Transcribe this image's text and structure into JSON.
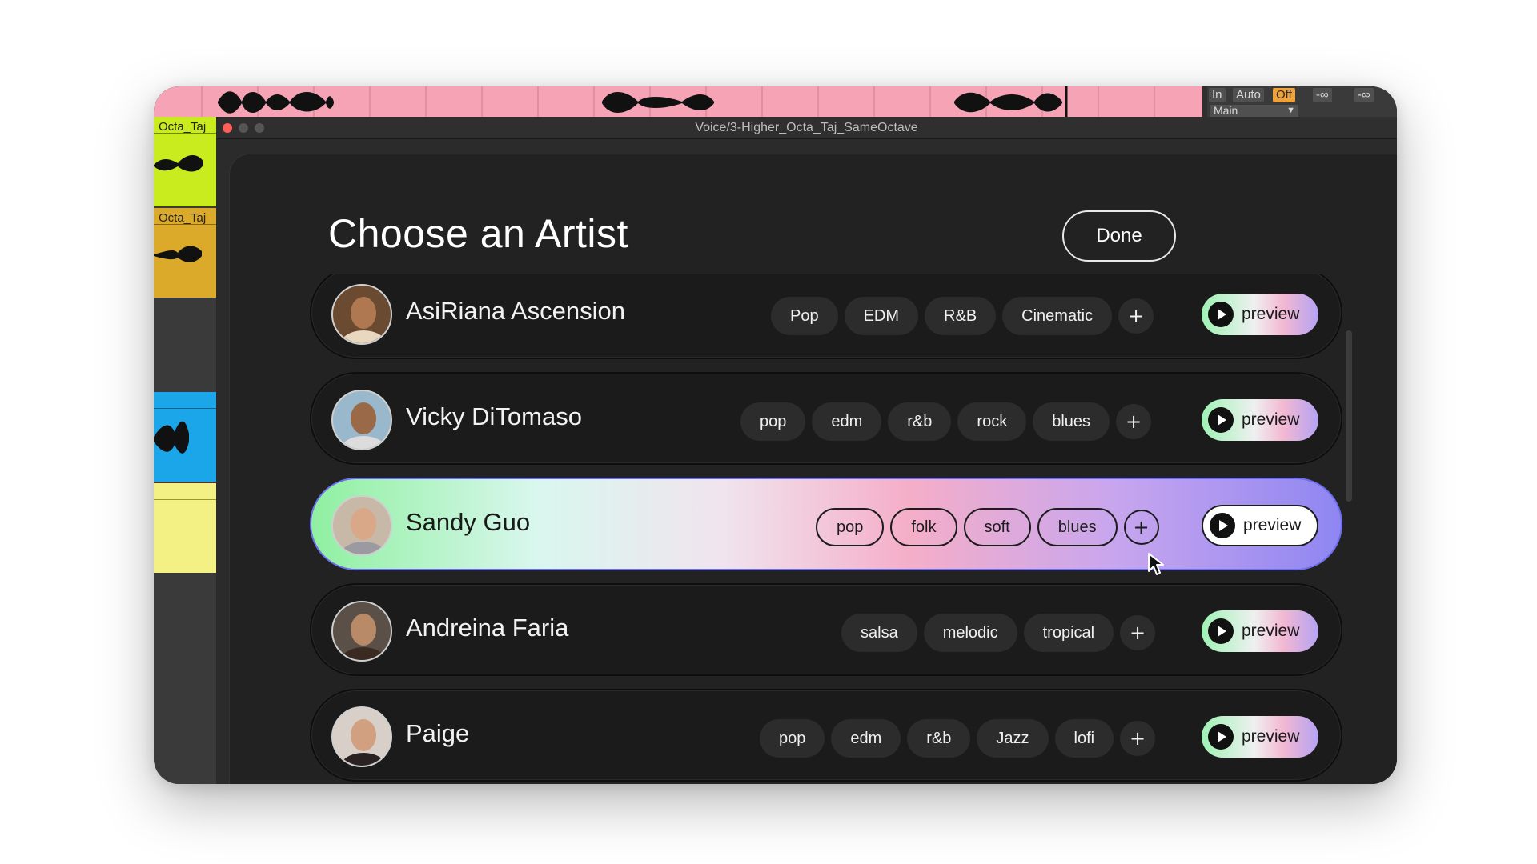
{
  "window": {
    "title": "Voice/3-Higher_Octa_Taj_SameOctave"
  },
  "daw": {
    "monitor": {
      "in": "In",
      "auto": "Auto",
      "off": "Off"
    },
    "meters": [
      "-∞",
      "-∞"
    ],
    "output": "Main",
    "lanes": [
      {
        "label": "Octa_Taj",
        "color": "#c8ec1e"
      },
      {
        "label": "Octa_Taj",
        "color": "#dcaa2a"
      },
      {
        "label": "",
        "color": "#1aa6e8"
      },
      {
        "label": "",
        "color": "#f3f084"
      }
    ],
    "clip_color": "#f5a3b5"
  },
  "heading": "Choose an Artist",
  "done_label": "Done",
  "preview_label": "preview",
  "add_tag_label": "+",
  "artists": [
    {
      "name": "AsiRiana Ascension",
      "tags": [
        "Pop",
        "EDM",
        "R&B",
        "Cinematic"
      ],
      "selected": false
    },
    {
      "name": "Vicky DiTomaso",
      "tags": [
        "pop",
        "edm",
        "r&b",
        "rock",
        "blues"
      ],
      "selected": false
    },
    {
      "name": "Sandy Guo",
      "tags": [
        "pop",
        "folk",
        "soft",
        "blues"
      ],
      "selected": true
    },
    {
      "name": "Andreina Faria",
      "tags": [
        "salsa",
        "melodic",
        "tropical"
      ],
      "selected": false
    },
    {
      "name": "Paige",
      "tags": [
        "pop",
        "edm",
        "r&b",
        "Jazz",
        "lofi"
      ],
      "selected": false
    }
  ],
  "colors": {
    "accent_gradient": [
      "#8ff0a0",
      "#f5aec8",
      "#8f86f2"
    ],
    "panel_bg": "#222222",
    "row_bg": "#1b1b1b"
  }
}
